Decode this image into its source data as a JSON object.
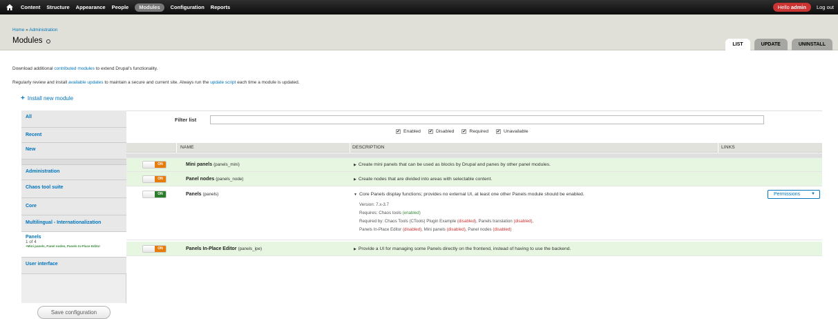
{
  "toolbar": {
    "items": [
      "Content",
      "Structure",
      "Appearance",
      "People",
      "Modules",
      "Configuration",
      "Reports"
    ],
    "hello_prefix": "Hello ",
    "user": "admin",
    "logout": "Log out"
  },
  "header": {
    "breadcrumb": [
      "Home",
      "Administration"
    ],
    "breadcrumb_sep": " » ",
    "title": "Modules",
    "tabs": [
      "LIST",
      "UPDATE",
      "UNINSTALL"
    ]
  },
  "intro": {
    "line1_a": "Download additional ",
    "line1_link": "contributed modules",
    "line1_b": " to extend Drupal's functionality.",
    "line2_a": "Regularly review and install ",
    "line2_link1": "available updates",
    "line2_b": " to maintain a secure and current site. Always run the ",
    "line2_link2": "update script",
    "line2_c": " each time a module is updated.",
    "install_link": "Install new module"
  },
  "sidebar": {
    "items": [
      "All",
      "Recent",
      "New",
      "Administration",
      "Chaos tool suite",
      "Core",
      "Multilingual - Internationalization",
      "Panels",
      "User interface"
    ],
    "panels_count": "1 of 4",
    "panels_summary": "+Mini panels, Panel nodes, Panels In-Place Editor",
    "save_label": "Save configuration"
  },
  "filter": {
    "label": "Filter list",
    "checks": [
      "Enabled",
      "Disabled",
      "Required",
      "Unavailable"
    ]
  },
  "table": {
    "headers": [
      "NAME",
      "DESCRIPTION",
      "LINKS"
    ],
    "rows": [
      {
        "toggle": "ON",
        "name": "Mini panels",
        "machine": "(panels_mini)",
        "desc": "Create mini panels that can be used as blocks by Drupal and panes by other panel modules."
      },
      {
        "toggle": "ON",
        "name": "Panel nodes",
        "machine": "(panels_node)",
        "desc": "Create nodes that are divided into areas with selectable content."
      },
      {
        "toggle": "ON",
        "name": "Panels",
        "machine": "(panels)",
        "desc": "Core Panels display functions; provides no external UI, at least one other Panels module should be enabled."
      },
      {
        "toggle": "ON",
        "name": "Panels In-Place Editor",
        "machine": "(panels_ipe)",
        "desc": "Provide a UI for managing some Panels directly on the frontend, instead of having to use the backend."
      }
    ],
    "panels_details": {
      "version": "Version: 7.x-3.7",
      "requires_a": "Requires: Chaos tools ",
      "requires_b": "(enabled)",
      "required_by_a": "Required by: Chaos Tools (CTools) Plugin Example ",
      "required_by_b": "(disabled)",
      "required_by_c": ", Panels translation ",
      "required_by_d": "(disabled)",
      "required_by_e": ",",
      "line4_a": "Panels In-Place Editor ",
      "line4_b": "(disabled)",
      "line4_c": ", Mini panels ",
      "line4_d": "(disabled)",
      "line4_e": ", Panel nodes ",
      "line4_f": "(disabled)"
    },
    "permissions_label": "Permissions"
  },
  "colors": {
    "toolbar_bg": "#1a1a1a",
    "active_pill": "#777777",
    "hello_bg": "#cc3333",
    "link": "#0074bd",
    "enabled_row": "#e6f6e0",
    "toggle_orange": "#e57c0b",
    "toggle_green": "#2b7d2b"
  }
}
